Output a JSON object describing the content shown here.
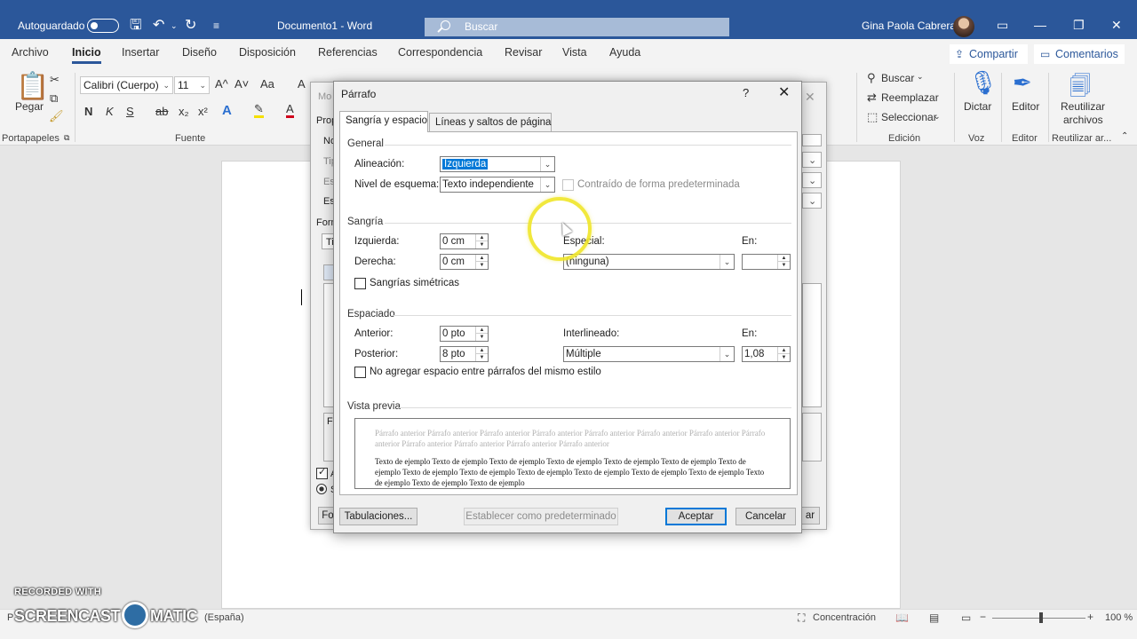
{
  "titlebar": {
    "autosave_label": "Autoguardado",
    "doc_title": "Documento1  -  Word",
    "search_placeholder": "Buscar",
    "user_name": "Gina Paola Cabrera",
    "accent": "#2b579a"
  },
  "menu": {
    "tabs": [
      "Archivo",
      "Inicio",
      "Insertar",
      "Diseño",
      "Disposición",
      "Referencias",
      "Correspondencia",
      "Revisar",
      "Vista",
      "Ayuda"
    ],
    "active": "Inicio",
    "share_label": "Compartir",
    "comments_label": "Comentarios"
  },
  "ribbon": {
    "paste_label": "Pegar",
    "clipboard_group": "Portapapeles",
    "font_name": "Calibri (Cuerpo)",
    "font_size": "11",
    "font_group": "Fuente",
    "bold": "N",
    "italic": "K",
    "underline": "S",
    "strike": "ab",
    "subscript": "x₂",
    "superscript": "x²",
    "grow_font": "A^",
    "shrink_font": "A˅",
    "change_case": "Aa",
    "find_label": "Buscar",
    "replace_label": "Reemplazar",
    "select_label": "Seleccionar",
    "editing_group": "Edición",
    "dictate_label": "Dictar",
    "voice_group": "Voz",
    "editor_label": "Editor",
    "editor_group": "Editor",
    "reuse_label_1": "Reutilizar",
    "reuse_label_2": "archivos",
    "reuse_group": "Reutilizar ar..."
  },
  "bg_dialog": {
    "title": "Mo",
    "props": "Prop",
    "name": "No",
    "type": "Tip",
    "style": "Est",
    "style2": "Es",
    "format": "Form",
    "ti": "Ti",
    "fu": "Fu",
    "a": "A",
    "s": "S",
    "fo": "Fo",
    "ar": "ar"
  },
  "dialog": {
    "title": "Párrafo",
    "help": "?",
    "close": "✕",
    "tabs": [
      "Sangría y espacio",
      "Líneas y saltos de página"
    ],
    "general": {
      "section": "General",
      "alignment_label": "Alineación:",
      "alignment_value": "Izquierda",
      "outline_label": "Nivel de esquema:",
      "outline_value": "Texto independiente",
      "collapsed_label": "Contraído de forma predeterminada"
    },
    "indent": {
      "section": "Sangría",
      "left_label": "Izquierda:",
      "left_value": "0 cm",
      "right_label": "Derecha:",
      "right_value": "0 cm",
      "special_label": "Especial:",
      "special_value": "(ninguna)",
      "by_label": "En:",
      "by_value": "",
      "mirror_label": "Sangrías simétricas"
    },
    "spacing": {
      "section": "Espaciado",
      "before_label": "Anterior:",
      "before_value": "0 pto",
      "after_label": "Posterior:",
      "after_value": "8 pto",
      "line_label": "Interlineado:",
      "line_value": "Múltiple",
      "at_label": "En:",
      "at_value": "1,08",
      "no_space_label": "No agregar espacio entre párrafos del mismo estilo"
    },
    "preview": {
      "section": "Vista previa",
      "prev_text": "Párrafo anterior Párrafo anterior Párrafo anterior Párrafo anterior Párrafo anterior Párrafo anterior Párrafo anterior Párrafo anterior Párrafo anterior Párrafo anterior Párrafo anterior Párrafo anterior",
      "sample_text": "Texto de ejemplo Texto de ejemplo Texto de ejemplo Texto de ejemplo Texto de ejemplo Texto de ejemplo Texto de ejemplo Texto de ejemplo Texto de ejemplo Texto de ejemplo Texto de ejemplo Texto de ejemplo Texto de ejemplo Texto de ejemplo Texto de ejemplo Texto de ejemplo"
    },
    "buttons": {
      "tabs": "Tabulaciones...",
      "set_default": "Establecer como predeterminado",
      "ok": "Aceptar",
      "cancel": "Cancelar"
    }
  },
  "statusbar": {
    "language": "(España)",
    "focus": "Concentración",
    "zoom": "100 %"
  },
  "watermark": {
    "line1": "RECORDED WITH",
    "line2a": "SCREENCAST",
    "line2b": "MATIC"
  }
}
